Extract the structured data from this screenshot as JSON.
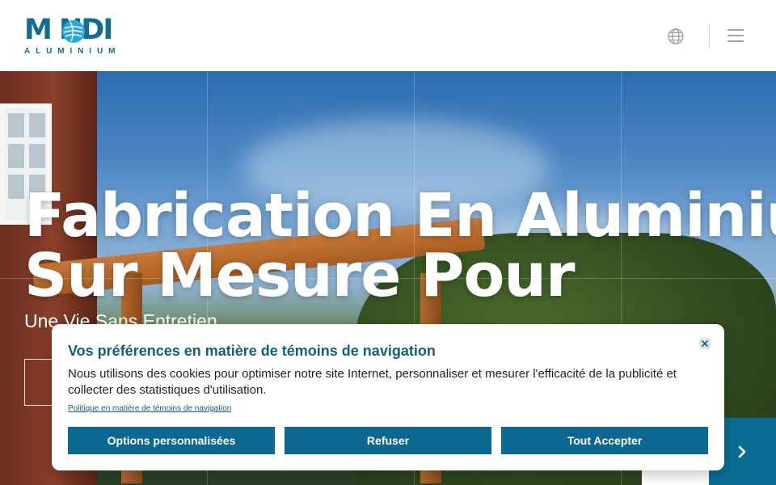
{
  "header": {
    "logo_word": "M NDI",
    "logo_sub": "ALUMINIUM",
    "brand_color": "#0f6d92"
  },
  "hero": {
    "title_line1": "Fabrication En Aluminium",
    "title_line2": "Sur Mesure Pour",
    "subtitle": "Une Vie Sans Entretien"
  },
  "slider": {
    "next_icon": "chevron-right-icon",
    "accent": "#0b6d93"
  },
  "cookie_banner": {
    "title": "Vos préférences en matière de témoins de navigation",
    "body": "Nous utilisons des cookies pour optimiser notre site Internet, personnaliser et mesurer l'efficacité de la publicité et collecter des statistiques d'utilisation.",
    "policy_link": "Politique en matière de témoins de navigation",
    "buttons": {
      "options": "Options personnalisées",
      "refuse": "Refuser",
      "accept": "Tout Accepter"
    }
  }
}
